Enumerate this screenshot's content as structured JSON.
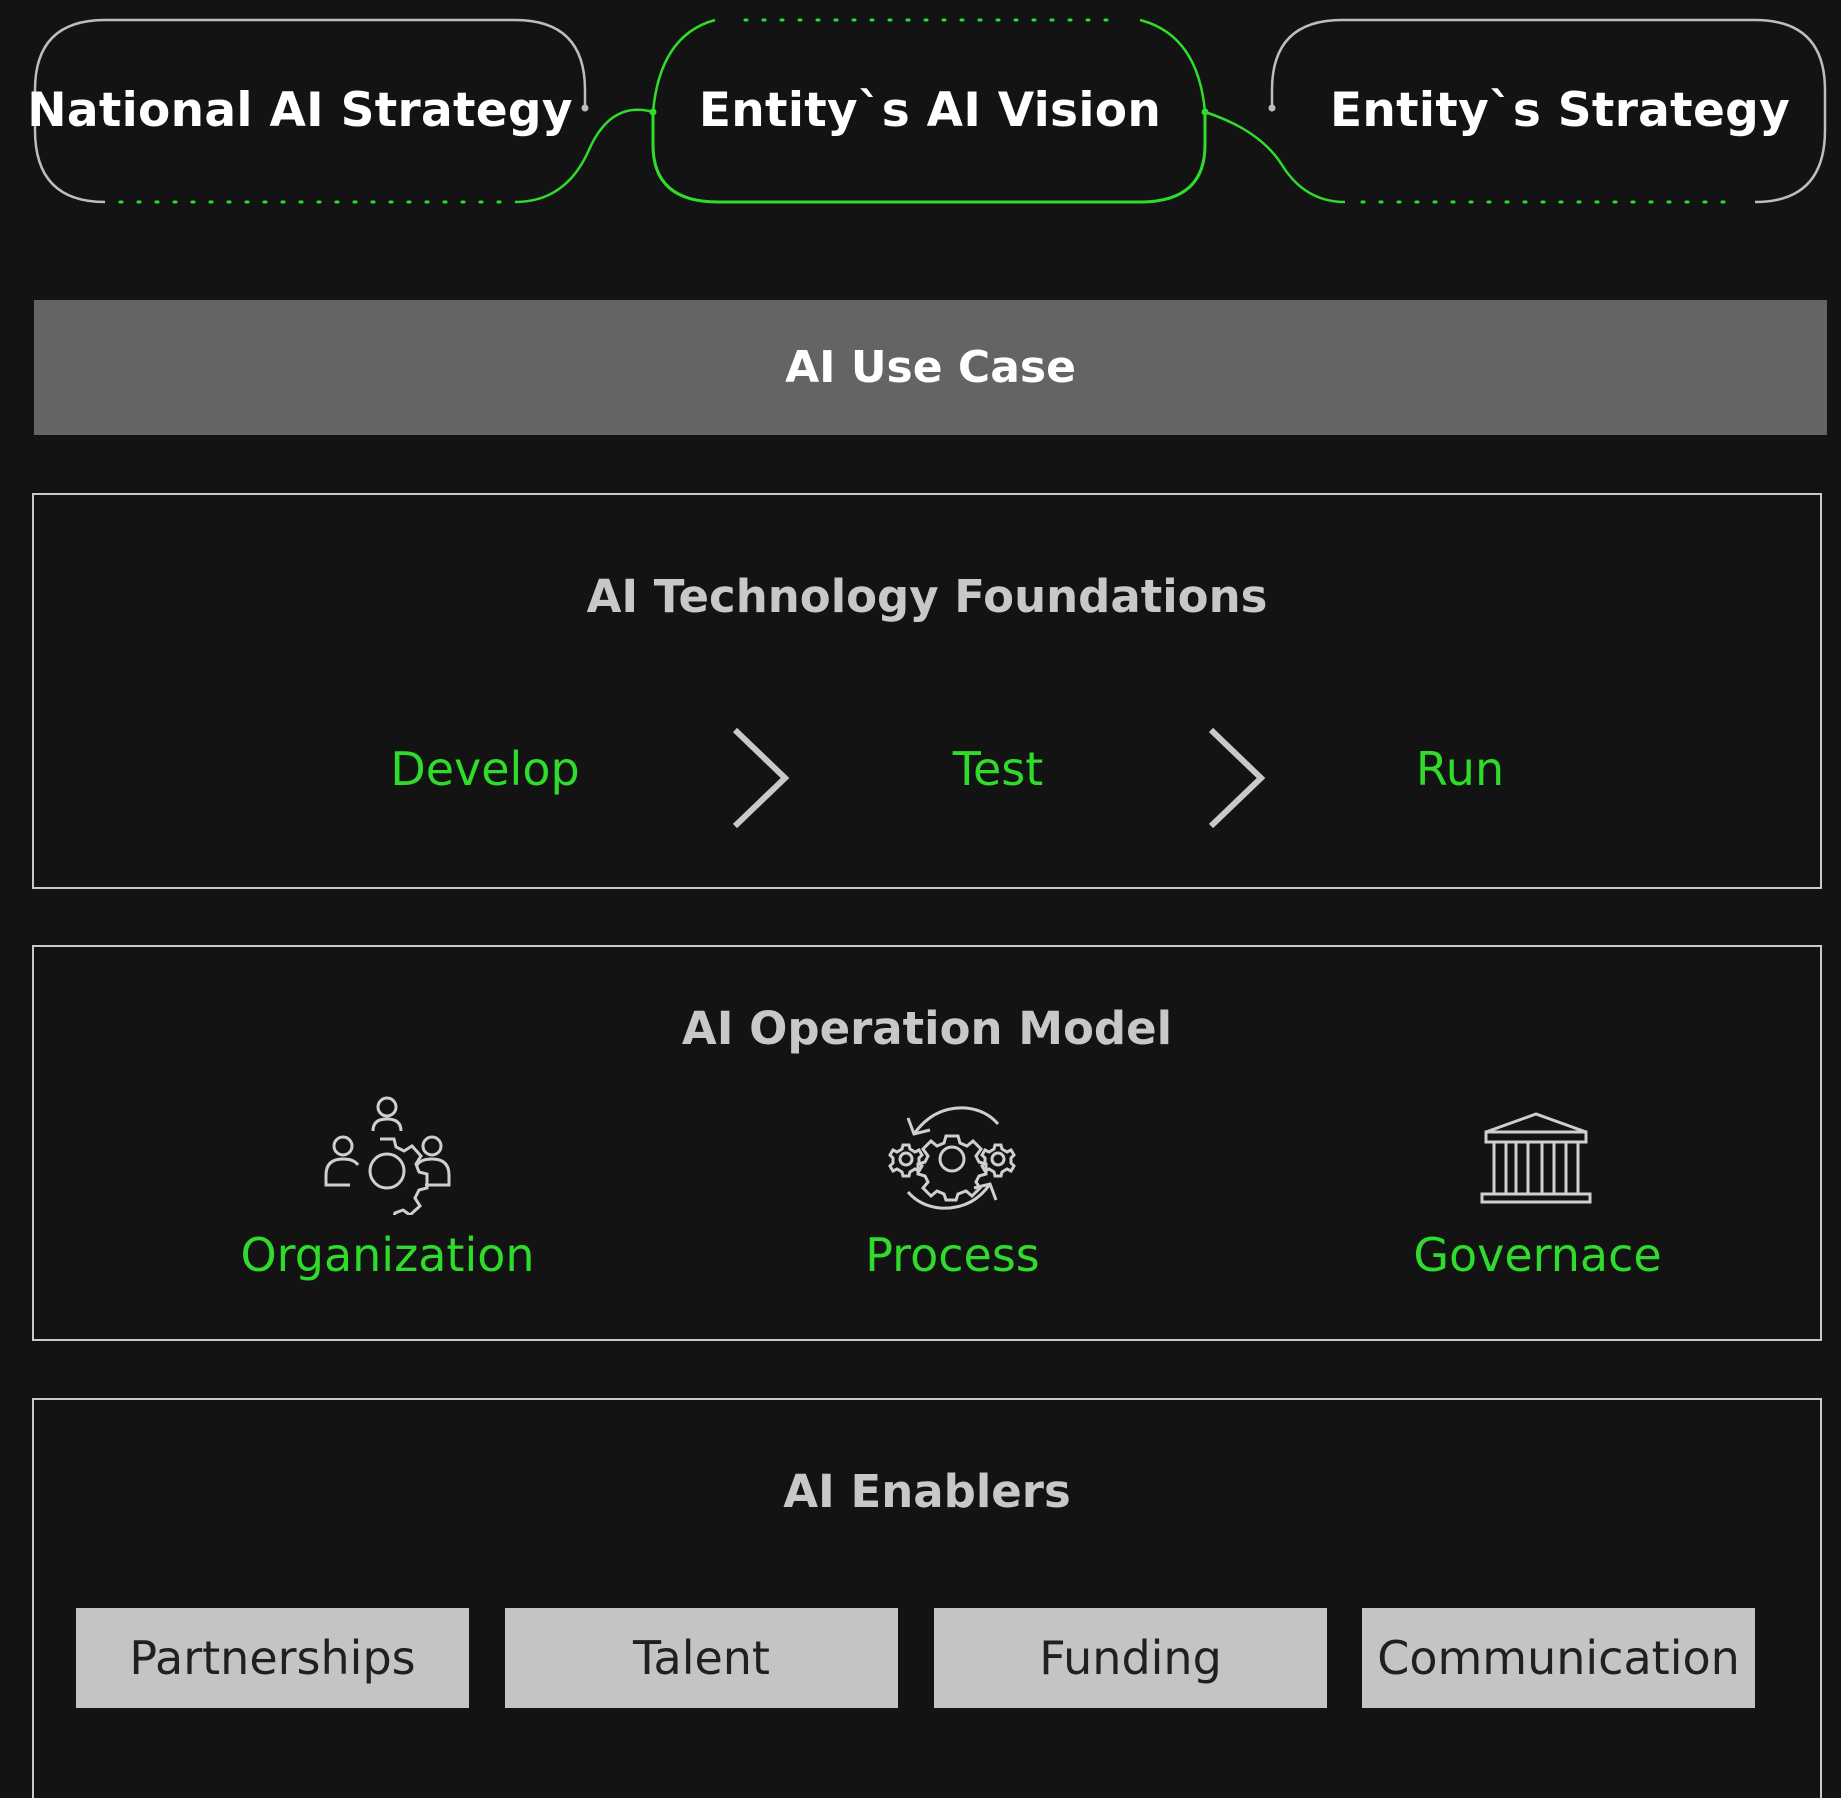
{
  "colors": {
    "background": "#131313",
    "accent_green": "#2fdc2b",
    "use_case_bar": "#636562",
    "enabler_box": "#c4c4c4",
    "panel_border": "#c9c9c9"
  },
  "header": {
    "national_strategy": "National AI Strategy",
    "entity_vision": "Entity`s AI Vision",
    "entity_strategy": "Entity`s Strategy"
  },
  "use_case": {
    "label": "AI Use Case"
  },
  "technology": {
    "title": "AI Technology Foundations",
    "steps": [
      "Develop",
      "Test",
      "Run"
    ],
    "separator_icon": "chevron-right-icon"
  },
  "operation": {
    "title": "AI Operation Model",
    "items": [
      {
        "label": "Organization",
        "icon": "people-gear-icon"
      },
      {
        "label": "Process",
        "icon": "gears-cycle-icon"
      },
      {
        "label": "Governace",
        "icon": "institution-icon"
      }
    ]
  },
  "enablers": {
    "title": "AI Enablers",
    "items": [
      "Partnerships",
      "Talent",
      "Funding",
      "Communication"
    ]
  }
}
